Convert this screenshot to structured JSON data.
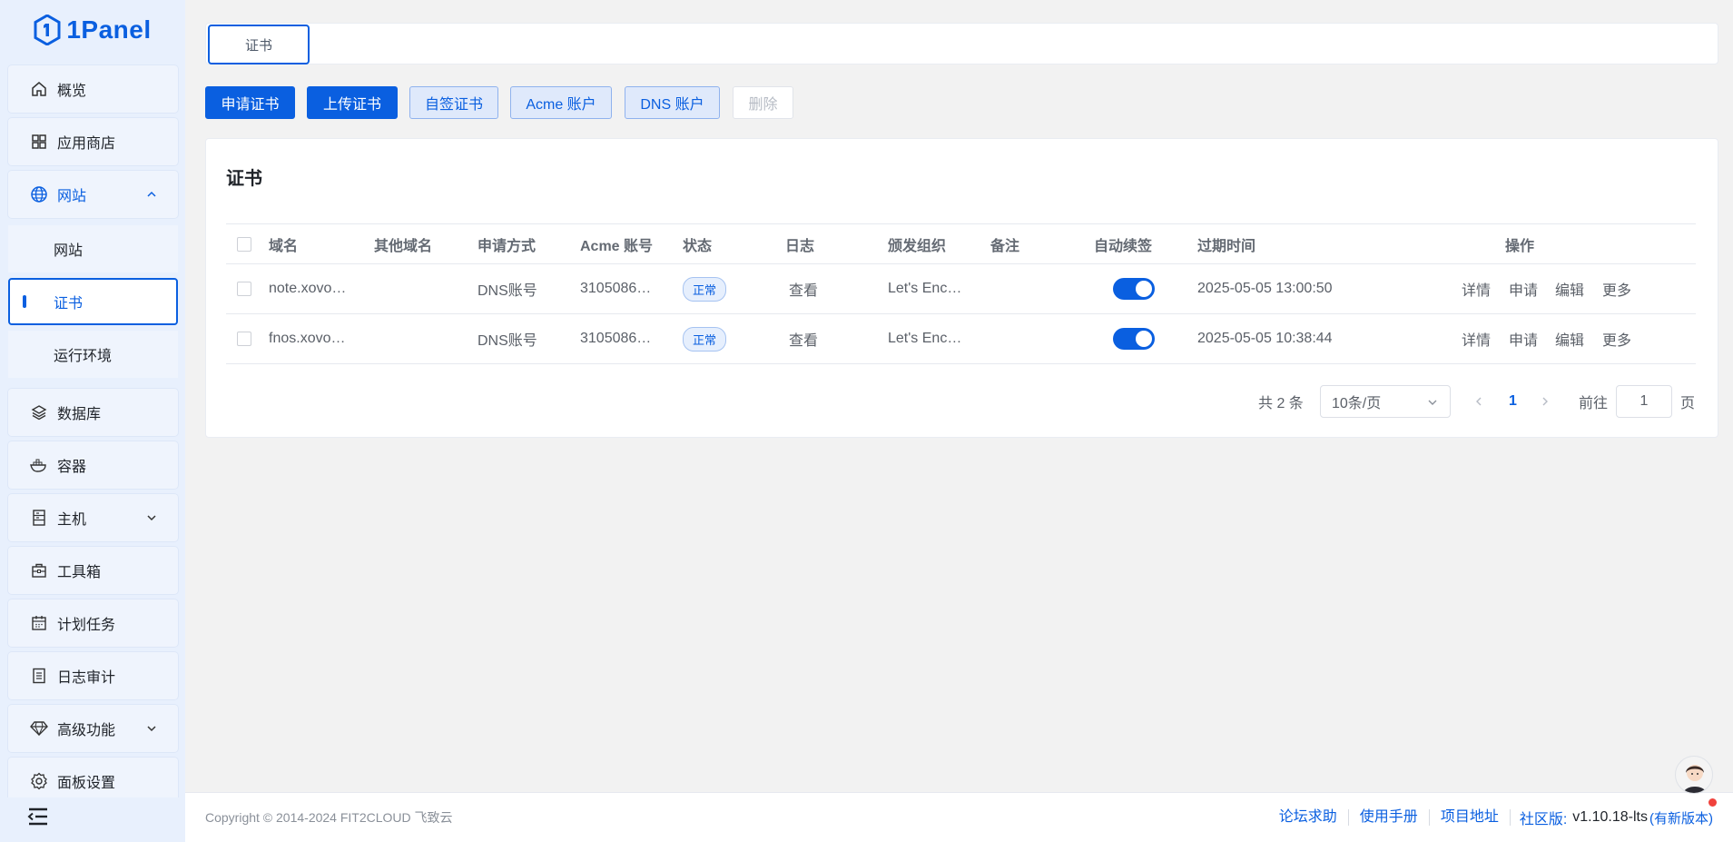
{
  "brand": {
    "name": "1Panel"
  },
  "sidebar": {
    "items": [
      {
        "label": "概览",
        "icon": "home-icon"
      },
      {
        "label": "应用商店",
        "icon": "grid-icon"
      },
      {
        "label": "网站",
        "icon": "globe-icon",
        "expanded": true
      },
      {
        "label": "数据库",
        "icon": "layers-icon"
      },
      {
        "label": "容器",
        "icon": "docker-icon"
      },
      {
        "label": "主机",
        "icon": "server-icon"
      },
      {
        "label": "工具箱",
        "icon": "toolbox-icon"
      },
      {
        "label": "计划任务",
        "icon": "calendar-icon"
      },
      {
        "label": "日志审计",
        "icon": "log-icon"
      },
      {
        "label": "高级功能",
        "icon": "diamond-icon"
      },
      {
        "label": "面板设置",
        "icon": "settings-icon"
      }
    ],
    "website_sub": [
      {
        "label": "网站"
      },
      {
        "label": "证书",
        "selected": true
      },
      {
        "label": "运行环境"
      }
    ]
  },
  "tabs": [
    {
      "label": "证书"
    }
  ],
  "toolbar": {
    "apply_cert": "申请证书",
    "upload_cert": "上传证书",
    "self_signed": "自签证书",
    "acme_account": "Acme 账户",
    "dns_account": "DNS 账户",
    "delete": "删除"
  },
  "card": {
    "title": "证书"
  },
  "table": {
    "columns": [
      "域名",
      "其他域名",
      "申请方式",
      "Acme 账号",
      "状态",
      "日志",
      "颁发组织",
      "备注",
      "自动续签",
      "过期时间",
      "操作"
    ],
    "rows": [
      {
        "domain": "note.xovo…",
        "other": "",
        "method": "DNS账号",
        "acme": "3105086…",
        "status": "正常",
        "log": "查看",
        "issuer": "Let's Enc…",
        "remark": "",
        "auto_renew": true,
        "expire": "2025-05-05 13:00:50"
      },
      {
        "domain": "fnos.xovo…",
        "other": "",
        "method": "DNS账号",
        "acme": "3105086…",
        "status": "正常",
        "log": "查看",
        "issuer": "Let's Enc…",
        "remark": "",
        "auto_renew": true,
        "expire": "2025-05-05 10:38:44"
      }
    ],
    "actions": [
      "详情",
      "申请",
      "编辑",
      "更多"
    ]
  },
  "pagination": {
    "total": "共 2 条",
    "page_size": "10条/页",
    "current_page": "1",
    "goto_label": "前往",
    "goto_value": "1",
    "page_suffix": "页"
  },
  "footer": {
    "copyright": "Copyright © 2014-2024 FIT2CLOUD 飞致云",
    "links": [
      "论坛求助",
      "使用手册",
      "项目地址"
    ],
    "edition": "社区版:",
    "version": "v1.10.18-lts",
    "new_version": "(有新版本)"
  },
  "colors": {
    "primary": "#0a5fe0",
    "sidebar_bg": "#e8f0fd"
  }
}
